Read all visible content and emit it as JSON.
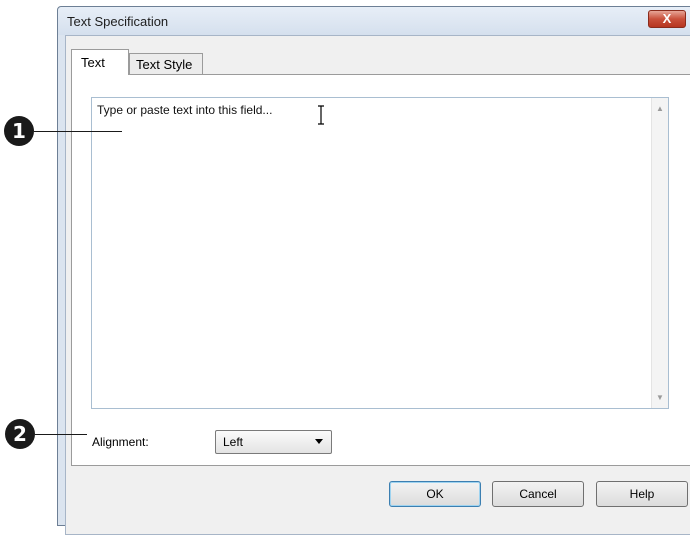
{
  "dialog": {
    "title": "Text Specification",
    "close_label": "X"
  },
  "tabs": [
    {
      "label": "Text"
    },
    {
      "label": "Text Style"
    }
  ],
  "text_field": {
    "placeholder": "Type or paste text into this field..."
  },
  "alignment": {
    "label": "Alignment:",
    "value": "Left"
  },
  "buttons": {
    "ok": "OK",
    "cancel": "Cancel",
    "help": "Help"
  },
  "callouts": [
    "1",
    "2"
  ]
}
